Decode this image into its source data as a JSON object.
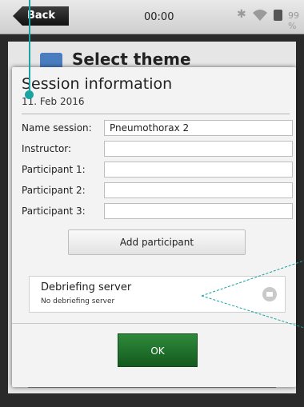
{
  "statusbar": {
    "back_label": "Back",
    "time": "00:00",
    "battery_text": "99 %"
  },
  "background_screen": {
    "title": "Select theme"
  },
  "dialog": {
    "title": "Session information",
    "date": "11. Feb 2016",
    "fields": [
      {
        "label": "Name session:",
        "value": "Pneumothorax 2"
      },
      {
        "label": "Instructor:",
        "value": ""
      },
      {
        "label": "Participant 1:",
        "value": ""
      },
      {
        "label": "Participant 2:",
        "value": ""
      },
      {
        "label": "Participant 3:",
        "value": ""
      }
    ],
    "add_participant_label": "Add participant",
    "debriefing": {
      "title": "Debriefing server",
      "subtitle": "No debriefing server"
    },
    "ok_label": "OK"
  },
  "colors": {
    "accent": "#1aa3a3",
    "ok_green": "#2f8a3a"
  }
}
